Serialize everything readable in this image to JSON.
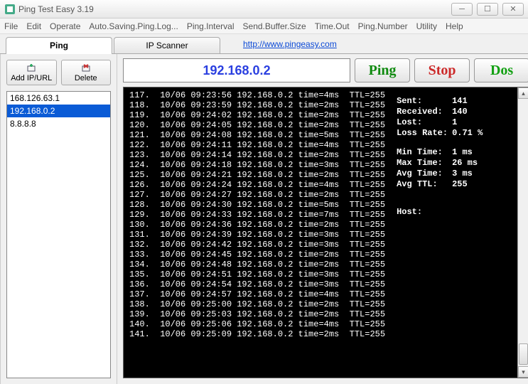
{
  "window": {
    "title": "Ping Test Easy 3.19"
  },
  "menu": [
    "File",
    "Edit",
    "Operate",
    "Auto.Saving.Ping.Log...",
    "Ping.Interval",
    "Send.Buffer.Size",
    "Time.Out",
    "Ping.Number",
    "Utility",
    "Help"
  ],
  "tabs": {
    "ping": "Ping",
    "scanner": "IP Scanner",
    "url": "http://www.pingeasy.com"
  },
  "toolbar": {
    "add": "Add IP/URL",
    "delete": "Delete"
  },
  "iplist": {
    "items": [
      "168.126.63.1",
      "192.168.0.2",
      "8.8.8.8"
    ],
    "selected": 1
  },
  "currentIP": "192.168.0.2",
  "buttons": {
    "ping": "Ping",
    "stop": "Stop",
    "dos": "Dos"
  },
  "log_lines": [
    "117.  10/06 09:23:56 192.168.0.2 time=4ms  TTL=255",
    "118.  10/06 09:23:59 192.168.0.2 time=2ms  TTL=255",
    "119.  10/06 09:24:02 192.168.0.2 time=2ms  TTL=255",
    "120.  10/06 09:24:05 192.168.0.2 time=2ms  TTL=255",
    "121.  10/06 09:24:08 192.168.0.2 time=5ms  TTL=255",
    "122.  10/06 09:24:11 192.168.0.2 time=4ms  TTL=255",
    "123.  10/06 09:24:14 192.168.0.2 time=2ms  TTL=255",
    "124.  10/06 09:24:18 192.168.0.2 time=3ms  TTL=255",
    "125.  10/06 09:24:21 192.168.0.2 time=2ms  TTL=255",
    "126.  10/06 09:24:24 192.168.0.2 time=4ms  TTL=255",
    "127.  10/06 09:24:27 192.168.0.2 time=2ms  TTL=255",
    "128.  10/06 09:24:30 192.168.0.2 time=5ms  TTL=255",
    "129.  10/06 09:24:33 192.168.0.2 time=7ms  TTL=255",
    "130.  10/06 09:24:36 192.168.0.2 time=2ms  TTL=255",
    "131.  10/06 09:24:39 192.168.0.2 time=3ms  TTL=255",
    "132.  10/06 09:24:42 192.168.0.2 time=3ms  TTL=255",
    "133.  10/06 09:24:45 192.168.0.2 time=2ms  TTL=255",
    "134.  10/06 09:24:48 192.168.0.2 time=2ms  TTL=255",
    "135.  10/06 09:24:51 192.168.0.2 time=3ms  TTL=255",
    "136.  10/06 09:24:54 192.168.0.2 time=3ms  TTL=255",
    "137.  10/06 09:24:57 192.168.0.2 time=4ms  TTL=255",
    "138.  10/06 09:25:00 192.168.0.2 time=2ms  TTL=255",
    "139.  10/06 09:25:03 192.168.0.2 time=2ms  TTL=255",
    "140.  10/06 09:25:06 192.168.0.2 time=4ms  TTL=255",
    "141.  10/06 09:25:09 192.168.0.2 time=2ms  TTL=255"
  ],
  "stats": {
    "sent_label": "Sent:",
    "sent": "141",
    "recv_label": "Received:",
    "recv": "140",
    "lost_label": "Lost:",
    "lost": "1",
    "rate_label": "Loss Rate:",
    "rate": "0.71 %",
    "min_label": "Min Time:",
    "min": "1 ms",
    "max_label": "Max Time:",
    "max": "26 ms",
    "avg_label": "Avg Time:",
    "avg": "3 ms",
    "ttl_label": "Avg TTL:",
    "ttl": "255",
    "host_label": "Host:"
  }
}
